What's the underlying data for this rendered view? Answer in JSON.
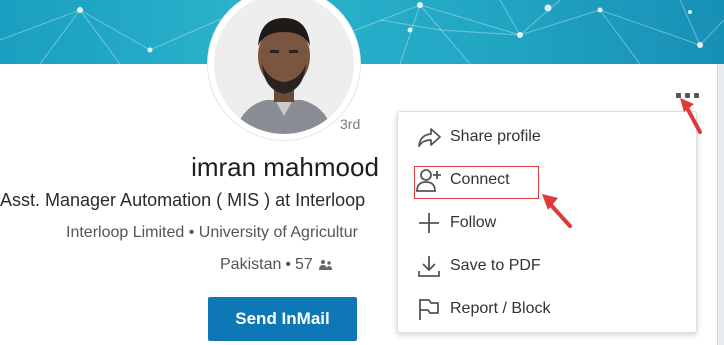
{
  "profile": {
    "name": "imran mahmood",
    "degree": "3rd",
    "headline": "Asst. Manager Automation ( MIS ) at Interloop",
    "subline": "Interloop Limited • University of Agricultur",
    "location": "Pakistan",
    "separator": "•",
    "connections": "57"
  },
  "actions": {
    "send_inmail_label": "Send InMail"
  },
  "menu": {
    "items": [
      {
        "label": "Share profile",
        "icon": "share-arrow-icon"
      },
      {
        "label": "Connect",
        "icon": "add-person-icon"
      },
      {
        "label": "Follow",
        "icon": "plus-icon"
      },
      {
        "label": "Save to PDF",
        "icon": "download-icon"
      },
      {
        "label": "Report / Block",
        "icon": "flag-icon"
      }
    ]
  },
  "colors": {
    "banner": "#22a7c4",
    "primary_button": "#0e77b5",
    "annotation_red": "#e0393c"
  }
}
